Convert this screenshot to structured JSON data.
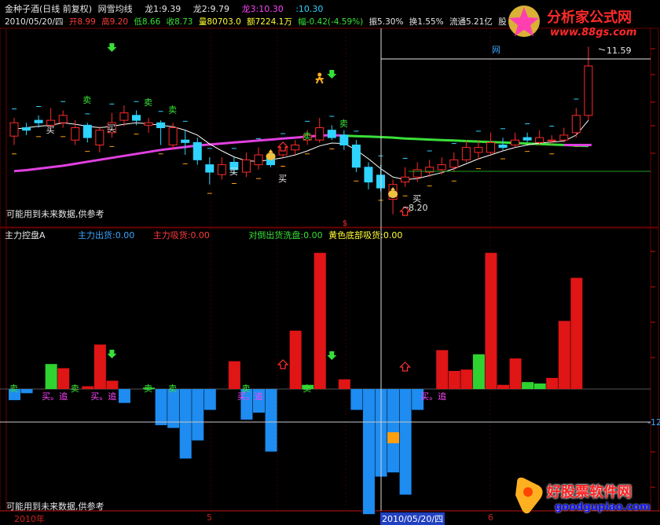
{
  "colors": {
    "up": "#ff2a2a",
    "down": "#2fd3ff",
    "ma_fast": "#ffffff",
    "ma_slow_pink": "#e040e0",
    "ma_slow_green": "#39e039",
    "text_red": "#ff3b3b",
    "text_yellow": "#ffff33",
    "text_blue": "#3aa4ff",
    "text_green": "#37e037",
    "text_magenta": "#ff44ff",
    "text_white": "#e6e6e6",
    "bar_red": "#e01515",
    "bar_green": "#2fd32f",
    "bar_blue": "#1e8cf0",
    "bar_orange": "#ff9f10",
    "grid": "#6b0000",
    "crosshair": "#d8d8d8"
  },
  "header": {
    "stock": "金种子酒(日线 前复权)",
    "indicator": "网雪均线",
    "long1": "龙1:9.39",
    "long2": "龙2:9.79",
    "long3": "龙3:10.30",
    "long4": ":10.30"
  },
  "infobar": {
    "date": "2010/05/20/四",
    "open": "开8.99",
    "high": "高9.20",
    "low": "低8.66",
    "close": "收8.73",
    "volume": "量80703.0",
    "amount": "额7224.1万",
    "change": "幅-0.42(-4.59%)",
    "amplitude": "振5.30%",
    "turnover": "换1.55%",
    "float": "流通5.21亿",
    "cut": "股"
  },
  "upper": {
    "note": "可能用到未来数据,供参考",
    "high_price_label": "11.59",
    "low_price_label": "8.20",
    "wang_label": "网",
    "labels": {
      "buy": "买",
      "sell": "卖",
      "dollar": "$"
    }
  },
  "lower": {
    "title": "主力控盘A",
    "out": "主力出货:0.00",
    "in": "主力吸货:0.00",
    "wash": "对倒出货洗盘:0.00",
    "yellow": "黄色底部吸货:0.00",
    "note": "可能用到未来数据,供参考",
    "buy_chase": "买。追",
    "axis_label": "-12"
  },
  "axis": {
    "year": "2010年",
    "m5": "5",
    "cursor_date": "2010/05/20/四",
    "m6": "6"
  },
  "watermark_top": {
    "title": "分析家公式网",
    "url": "www.88gs.com"
  },
  "watermark_bottom": {
    "title": "好股票软件网",
    "url": "goodgupiao.com"
  },
  "chart_data": {
    "type": "candlestick",
    "candles": [
      {
        "o": 9.78,
        "c": 10.05,
        "h": 10.15,
        "l": 9.6
      },
      {
        "o": 9.95,
        "c": 9.9,
        "h": 10.05,
        "l": 9.8
      },
      {
        "o": 10.1,
        "c": 10.05,
        "h": 10.2,
        "l": 9.95
      },
      {
        "o": 10.0,
        "c": 10.1,
        "h": 10.35,
        "l": 9.9
      },
      {
        "o": 10.05,
        "c": 10.2,
        "h": 10.3,
        "l": 9.95
      },
      {
        "o": 9.7,
        "c": 9.95,
        "h": 10.1,
        "l": 9.6
      },
      {
        "o": 10.0,
        "c": 9.75,
        "h": 10.05,
        "l": 9.65
      },
      {
        "o": 9.6,
        "c": 9.9,
        "h": 9.98,
        "l": 9.45
      },
      {
        "o": 9.85,
        "c": 10.05,
        "h": 10.25,
        "l": 9.75
      },
      {
        "o": 10.1,
        "c": 10.25,
        "h": 10.4,
        "l": 9.98
      },
      {
        "o": 10.2,
        "c": 10.1,
        "h": 10.3,
        "l": 10.0
      },
      {
        "o": 10.0,
        "c": 10.05,
        "h": 10.15,
        "l": 9.85
      },
      {
        "o": 10.05,
        "c": 9.95,
        "h": 10.1,
        "l": 9.6
      },
      {
        "o": 9.6,
        "c": 9.95,
        "h": 10.05,
        "l": 9.5
      },
      {
        "o": 9.7,
        "c": 9.65,
        "h": 9.9,
        "l": 9.4
      },
      {
        "o": 9.65,
        "c": 9.3,
        "h": 9.75,
        "l": 9.2
      },
      {
        "o": 9.2,
        "c": 9.05,
        "h": 9.35,
        "l": 8.8
      },
      {
        "o": 9.0,
        "c": 9.2,
        "h": 9.35,
        "l": 8.9
      },
      {
        "o": 9.25,
        "c": 9.1,
        "h": 9.35,
        "l": 9.0
      },
      {
        "o": 9.05,
        "c": 9.3,
        "h": 9.45,
        "l": 8.95
      },
      {
        "o": 9.2,
        "c": 9.4,
        "h": 9.55,
        "l": 9.1
      },
      {
        "o": 9.35,
        "c": 9.2,
        "h": 9.45,
        "l": 9.15
      },
      {
        "o": 9.4,
        "c": 9.55,
        "h": 9.65,
        "l": 9.35
      },
      {
        "o": 9.5,
        "c": 9.6,
        "h": 9.7,
        "l": 9.4
      },
      {
        "o": 9.7,
        "c": 9.8,
        "h": 9.9,
        "l": 9.6
      },
      {
        "o": 9.7,
        "c": 9.95,
        "h": 10.15,
        "l": 9.65
      },
      {
        "o": 9.9,
        "c": 9.75,
        "h": 10.0,
        "l": 9.7
      },
      {
        "o": 9.8,
        "c": 9.6,
        "h": 9.9,
        "l": 9.5
      },
      {
        "o": 9.6,
        "c": 9.15,
        "h": 9.7,
        "l": 9.05
      },
      {
        "o": 9.15,
        "c": 8.85,
        "h": 9.25,
        "l": 8.7
      },
      {
        "o": 8.99,
        "c": 8.73,
        "h": 9.2,
        "l": 8.66
      },
      {
        "o": 8.5,
        "c": 8.8,
        "h": 8.9,
        "l": 8.2
      },
      {
        "o": 8.85,
        "c": 8.95,
        "h": 9.15,
        "l": 8.75
      },
      {
        "o": 8.95,
        "c": 9.1,
        "h": 9.25,
        "l": 8.85
      },
      {
        "o": 9.05,
        "c": 9.15,
        "h": 9.3,
        "l": 8.95
      },
      {
        "o": 9.1,
        "c": 9.2,
        "h": 9.35,
        "l": 9.0
      },
      {
        "o": 9.15,
        "c": 9.3,
        "h": 9.45,
        "l": 9.05
      },
      {
        "o": 9.3,
        "c": 9.55,
        "h": 9.7,
        "l": 9.25
      },
      {
        "o": 9.45,
        "c": 9.55,
        "h": 9.7,
        "l": 9.3
      },
      {
        "o": 9.45,
        "c": 9.65,
        "h": 9.85,
        "l": 9.4
      },
      {
        "o": 9.6,
        "c": 9.55,
        "h": 9.75,
        "l": 9.5
      },
      {
        "o": 9.6,
        "c": 9.7,
        "h": 9.85,
        "l": 9.55
      },
      {
        "o": 9.75,
        "c": 9.7,
        "h": 9.85,
        "l": 9.65
      },
      {
        "o": 9.65,
        "c": 9.75,
        "h": 9.9,
        "l": 9.6
      },
      {
        "o": 9.7,
        "c": 9.7,
        "h": 9.8,
        "l": 9.6
      },
      {
        "o": 9.7,
        "c": 9.8,
        "h": 9.95,
        "l": 9.65
      },
      {
        "o": 9.85,
        "c": 10.2,
        "h": 10.35,
        "l": 9.75
      },
      {
        "o": 10.2,
        "c": 11.2,
        "h": 11.59,
        "l": 10.1
      }
    ],
    "ma_fast": [
      9.92,
      9.95,
      9.98,
      10.0,
      10.05,
      10.02,
      9.98,
      9.95,
      9.98,
      10.02,
      10.05,
      10.03,
      10.0,
      9.97,
      9.9,
      9.8,
      9.62,
      9.48,
      9.36,
      9.28,
      9.27,
      9.3,
      9.34,
      9.4,
      9.48,
      9.58,
      9.64,
      9.63,
      9.5,
      9.32,
      9.12,
      8.95,
      8.9,
      8.92,
      8.98,
      9.04,
      9.12,
      9.22,
      9.32,
      9.4,
      9.48,
      9.55,
      9.6,
      9.64,
      9.66,
      9.68,
      9.8,
      10.1
    ],
    "ma_slow": [
      9.07,
      9.09,
      9.12,
      9.15,
      9.18,
      9.22,
      9.26,
      9.3,
      9.34,
      9.38,
      9.42,
      9.46,
      9.5,
      9.53,
      9.56,
      9.59,
      9.61,
      9.63,
      9.65,
      9.67,
      9.69,
      9.71,
      9.73,
      9.75,
      9.77,
      9.79,
      9.8,
      9.79,
      9.78,
      9.77,
      9.76,
      9.75,
      9.73,
      9.72,
      9.71,
      9.7,
      9.69,
      9.68,
      9.67,
      9.66,
      9.65,
      9.64,
      9.63,
      9.62,
      9.61,
      9.6,
      9.59,
      9.58
    ],
    "osc_values": [
      -8,
      -3,
      0,
      18,
      15,
      0,
      2,
      32,
      6,
      -10,
      0,
      1,
      -26,
      -28,
      -50,
      -37,
      -15,
      0,
      20,
      -22,
      -17,
      -45,
      0,
      42,
      3,
      98,
      0,
      7,
      -15,
      -90,
      -63,
      -60,
      -76,
      -15,
      0,
      28,
      13,
      14,
      25,
      98,
      3,
      22,
      5,
      4,
      8,
      49,
      80
    ],
    "ylim": [
      8.0,
      11.9
    ],
    "osc_ylim": [
      -102,
      108
    ]
  }
}
